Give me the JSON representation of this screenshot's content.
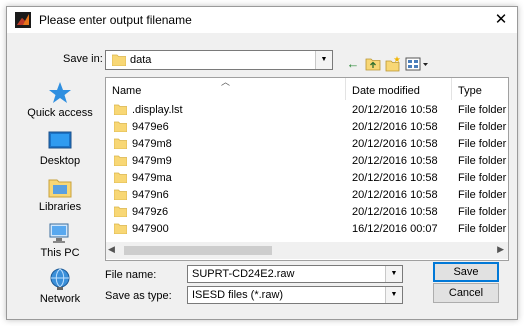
{
  "window": {
    "title": "Please enter output filename",
    "close_label": "✕"
  },
  "toolbar": {
    "save_in_label": "Save in:",
    "save_in_value": "data"
  },
  "places": [
    {
      "label": "Quick access",
      "icon": "star-icon"
    },
    {
      "label": "Desktop",
      "icon": "desktop-icon"
    },
    {
      "label": "Libraries",
      "icon": "libraries-icon"
    },
    {
      "label": "This PC",
      "icon": "computer-icon"
    },
    {
      "label": "Network",
      "icon": "network-icon"
    }
  ],
  "columns": {
    "name": "Name",
    "date": "Date modified",
    "type": "Type"
  },
  "files": [
    {
      "name": ".display.lst",
      "date": "20/12/2016 10:58",
      "type": "File folder"
    },
    {
      "name": "9479e6",
      "date": "20/12/2016 10:58",
      "type": "File folder"
    },
    {
      "name": "9479m8",
      "date": "20/12/2016 10:58",
      "type": "File folder"
    },
    {
      "name": "9479m9",
      "date": "20/12/2016 10:58",
      "type": "File folder"
    },
    {
      "name": "9479ma",
      "date": "20/12/2016 10:58",
      "type": "File folder"
    },
    {
      "name": "9479n6",
      "date": "20/12/2016 10:58",
      "type": "File folder"
    },
    {
      "name": "9479z6",
      "date": "20/12/2016 10:58",
      "type": "File folder"
    },
    {
      "name": "947900",
      "date": "16/12/2016 00:07",
      "type": "File folder"
    }
  ],
  "form": {
    "filename_label": "File name:",
    "filename_value": "SUPRT-CD24E2.raw",
    "savetype_label": "Save as type:",
    "savetype_value": "ISESD files (*.raw)"
  },
  "buttons": {
    "save": "Save",
    "cancel": "Cancel"
  },
  "colors": {
    "folder": "#f8d775",
    "accent": "#0078d7"
  }
}
